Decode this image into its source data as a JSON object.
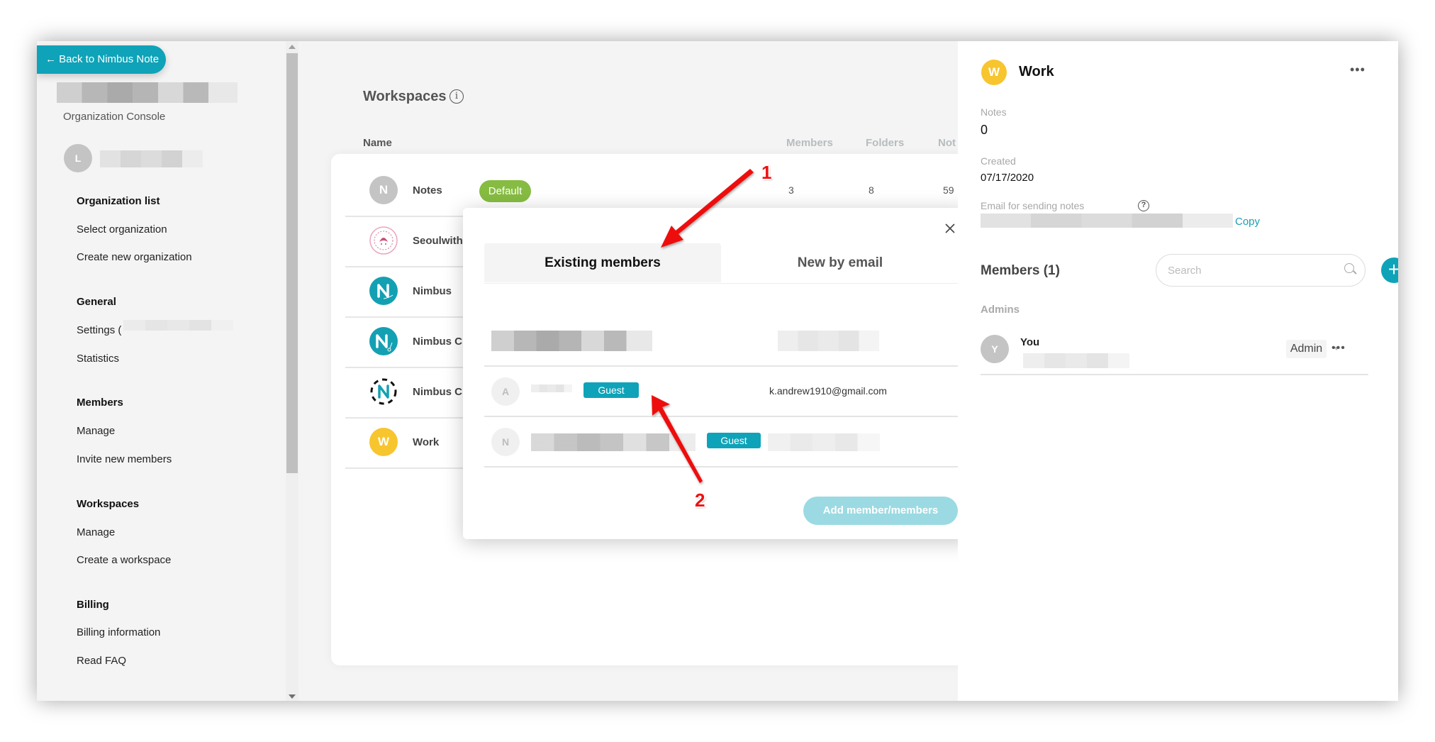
{
  "sidebar": {
    "back_button": "← Back to Nimbus Note",
    "subtitle": "Organization Console",
    "user_avatar_letter": "L",
    "sections": [
      {
        "title": "Organization list",
        "items": [
          "Select organization",
          "Create new organization"
        ]
      },
      {
        "title": "General",
        "items": [
          "Settings (",
          "Statistics"
        ]
      },
      {
        "title": "Members",
        "items": [
          "Manage",
          "Invite new members"
        ]
      },
      {
        "title": "Workspaces",
        "items": [
          "Manage",
          "Create a workspace"
        ]
      },
      {
        "title": "Billing",
        "items": [
          "Billing information",
          "Read FAQ"
        ]
      }
    ]
  },
  "main": {
    "title": "Workspaces",
    "info_icon": "i",
    "columns": [
      "Name",
      "Members",
      "Folders",
      "Not"
    ],
    "rows": [
      {
        "avatar": "N",
        "avatar_color": "#c4c4c4",
        "name": "Notes",
        "badge": "Default",
        "members": "3",
        "folders": "8",
        "notes": "59"
      },
      {
        "avatar": "seoul-with-love-logo",
        "name": "Seoulwith"
      },
      {
        "avatar": "nimbus-logo",
        "name": "Nimbus"
      },
      {
        "avatar": "nimbus-clip-logo",
        "name": "Nimbus C"
      },
      {
        "avatar": "nimbus-dashed-logo",
        "name": "Nimbus C"
      },
      {
        "avatar": "W",
        "avatar_color": "#f7c52e",
        "name": "Work"
      }
    ]
  },
  "modal": {
    "tabs": [
      {
        "label": "Existing members",
        "active": true
      },
      {
        "label": "New by email",
        "active": false
      }
    ],
    "members": [
      {
        "avatar": "",
        "role": "",
        "email": ""
      },
      {
        "avatar": "A",
        "role": "Guest",
        "email": "k.andrew1910@gmail.com"
      },
      {
        "avatar": "N",
        "role": "Guest",
        "email": ""
      }
    ],
    "add_button": "Add member/members"
  },
  "panel": {
    "avatar": "W",
    "title": "Work",
    "more": "•••",
    "notes_label": "Notes",
    "notes_value": "0",
    "created_label": "Created",
    "created_value": "07/17/2020",
    "email_label": "Email for sending notes",
    "help_icon": "?",
    "copy_label": "Copy",
    "members_title": "Members (1)",
    "search_placeholder": "Search",
    "add_icon": "+",
    "admins_label": "Admins",
    "member": {
      "avatar": "Y",
      "name": "You",
      "role": "Admin",
      "more": "•••"
    }
  },
  "annotations": {
    "label_1": "1",
    "label_2": "2"
  },
  "colors": {
    "accent": "#0ea3b8",
    "default_badge": "#86bc42",
    "work_avatar": "#f7c52e",
    "annotation": "#ee1111"
  }
}
